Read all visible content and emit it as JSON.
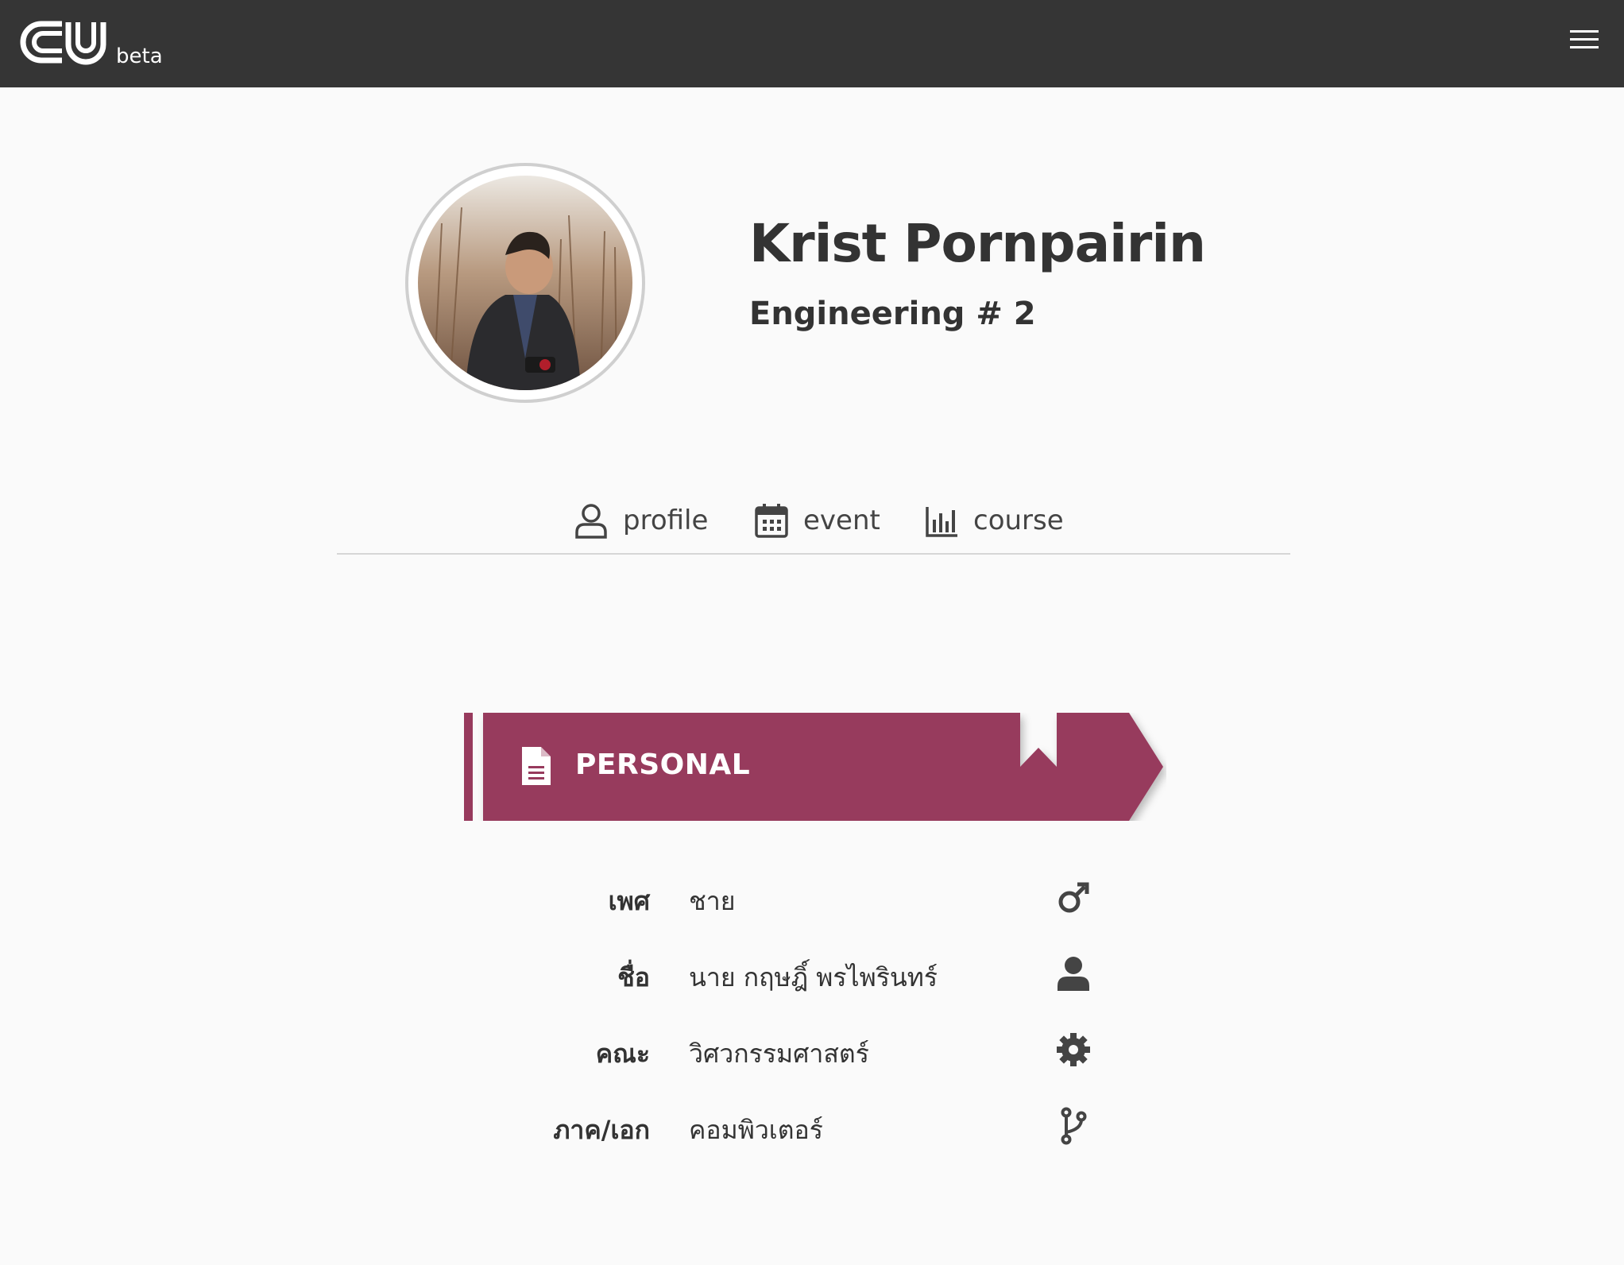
{
  "navbar": {
    "logo_text": "CU",
    "badge": "beta",
    "menu_icon": "hamburger-menu-icon"
  },
  "profile": {
    "name": "Krist Pornpairin",
    "subtitle": "Engineering # 2",
    "avatar_alt": "profile photo"
  },
  "tabs": [
    {
      "label": "profile",
      "icon": "user-outline-icon"
    },
    {
      "label": "event",
      "icon": "calendar-icon"
    },
    {
      "label": "course",
      "icon": "bar-chart-icon"
    }
  ],
  "section": {
    "title": "PERSONAL",
    "icon": "document-icon",
    "accent_color": "#973a5d"
  },
  "personal": [
    {
      "label": "เพศ",
      "value": "ชาย",
      "icon": "male-icon"
    },
    {
      "label": "ชื่อ",
      "value": "นาย กฤษฎิ์ พรไพรินทร์",
      "icon": "user-icon"
    },
    {
      "label": "คณะ",
      "value": "วิศวกรรมศาสตร์",
      "icon": "gear-icon"
    },
    {
      "label": "ภาค/เอก",
      "value": "คอมพิวเตอร์",
      "icon": "branch-icon"
    }
  ]
}
